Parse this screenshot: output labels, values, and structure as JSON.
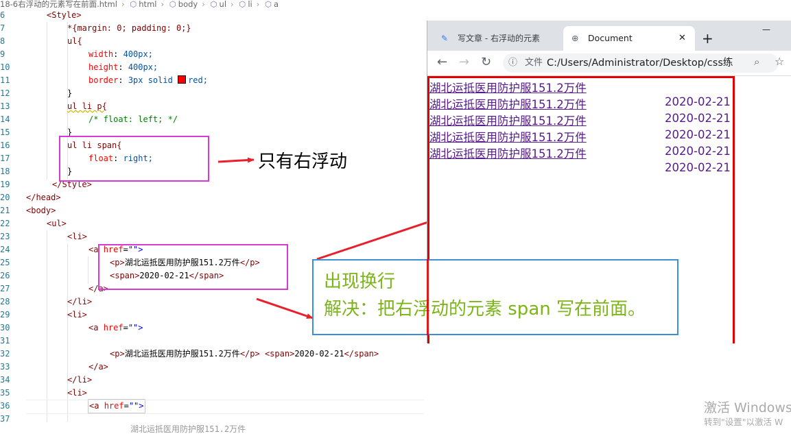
{
  "breadcrumb": {
    "file": "18-6右浮动的元素写在前面.html",
    "items": [
      "html",
      "body",
      "ul",
      "li",
      "a"
    ]
  },
  "editor": {
    "line_numbers": [
      "6",
      "7",
      "8",
      "9",
      "10",
      "11",
      "12",
      "13",
      "14",
      "15",
      "16",
      "17",
      "18",
      "19",
      "20",
      "21",
      "22",
      "23",
      "24",
      "25",
      "26",
      "27",
      "28",
      "29",
      "30",
      "31",
      "32",
      "33",
      "34",
      "35",
      "36",
      "37"
    ],
    "lines": {
      "l6": "<Style>",
      "l7": "*{margin: 0; padding: 0;}",
      "l8": "ul{",
      "l9_p": "width",
      "l9_v": "400px;",
      "l10_p": "height",
      "l10_v": "400px;",
      "l11_p": "border",
      "l11_v": "3px solid",
      "l11_c": "red;",
      "l12": "}",
      "l13": "ul li p{",
      "l14": "/* float: left; */",
      "l15": "}",
      "l16": "ul li span{",
      "l17_p": "float",
      "l17_v": "right;",
      "l18": "}",
      "l19": "</Style>",
      "l20": "</head>",
      "l21": "<body>",
      "l22": "<ul>",
      "l23": "<li>",
      "l24_a": "<a",
      "l24_h": "href",
      "l24_s": "\"\">",
      "l25_o": "<p>",
      "l25_t": "湖北运抵医用防护服151.2万件",
      "l25_c": "</p>",
      "l26_o": "<span>",
      "l26_t": "2020-02-21",
      "l26_c": "</span>",
      "l27": "</a>",
      "l28": "</li>",
      "l29": "<li>",
      "l30_a": "<a",
      "l30_h": "href",
      "l30_s": "\"\">",
      "l32_o": "<p>",
      "l32_t": "湖北运抵医用防护服151.2万件",
      "l32_c": "</p>",
      "l32_so": "<span>",
      "l32_st": "2020-02-21",
      "l32_sc": "</span>",
      "l33": "</a>",
      "l34": "</li>",
      "l35": "<li>",
      "l36_a": "<a",
      "l36_h": "href",
      "l36_s": "\"\">",
      "l37_t": "湖北运抵医用防护服151.2万件"
    }
  },
  "annotations": {
    "only_right_float": "只有右浮动",
    "callout_line1": "出现换行",
    "callout_line2": "解决：把右浮动的元素 span 写在前面。"
  },
  "browser": {
    "tab_inactive": "写文章 - 右浮动的元素",
    "tab_active": "Document",
    "new_tab": "+",
    "address_label": "文件",
    "address": "C:/Users/Administrator/Desktop/css练",
    "minimize": "—",
    "tab_close": "✕",
    "page": {
      "links": [
        "湖北运抵医用防护服151.2万件",
        "湖北运抵医用防护服151.2万件",
        "湖北运抵医用防护服151.2万件",
        "湖北运抵医用防护服151.2万件",
        "湖北运抵医用防护服151.2万件"
      ],
      "dates": [
        "2020-02-21",
        "2020-02-21",
        "2020-02-21",
        "2020-02-21",
        "2020-02-21"
      ]
    }
  },
  "watermark": {
    "line1": "激活 Windows",
    "line2": "转到\"设置\"以激活 W"
  },
  "colors": {
    "magenta_box": "#d63ad6",
    "blue_box": "#3b8fd6",
    "arrow_red": "#e8202a",
    "callout_green": "#7cb518",
    "ul_border": "#e00000"
  }
}
